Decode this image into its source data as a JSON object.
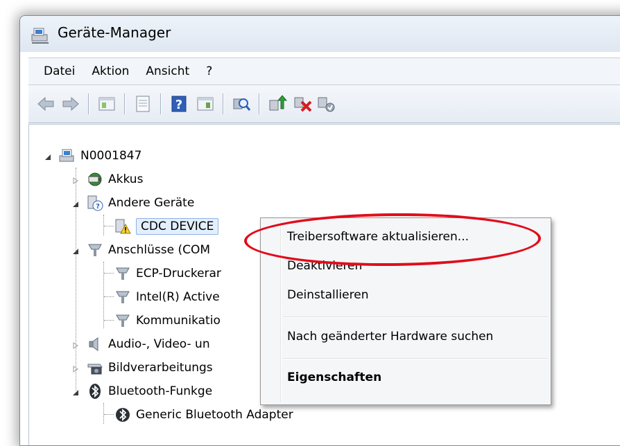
{
  "window": {
    "title": "Geräte-Manager"
  },
  "menu": [
    "Datei",
    "Aktion",
    "Ansicht",
    "?"
  ],
  "toolbar": [
    "back-icon",
    "forward-icon",
    "properties-icon",
    "print-icon",
    "help-icon",
    "show-hidden-icon",
    "scan-hardware-icon",
    "update-driver-icon",
    "uninstall-icon",
    "disable-icon"
  ],
  "tree": {
    "root": "N0001847",
    "akkus": "Akkus",
    "andere": "Andere Geräte",
    "cdc": "CDC DEVICE",
    "anschluesse": "Anschlüsse (COM",
    "ecp": "ECP-Druckerar",
    "intel": "Intel(R) Active",
    "kommunikation": "Kommunikatio",
    "audio": "Audio-, Video- un",
    "bild": "Bildverarbeitungs",
    "bluetooth": "Bluetooth-Funkge",
    "generic_bt": "Generic Bluetooth Adapter"
  },
  "context_menu": {
    "update": "Treibersoftware aktualisieren...",
    "disable": "Deaktivieren",
    "uninstall": "Deinstallieren",
    "scan": "Nach geänderter Hardware suchen",
    "properties": "Eigenschaften"
  },
  "colors": {
    "annotation": "#e10d1b",
    "selection": "#e3effd"
  }
}
